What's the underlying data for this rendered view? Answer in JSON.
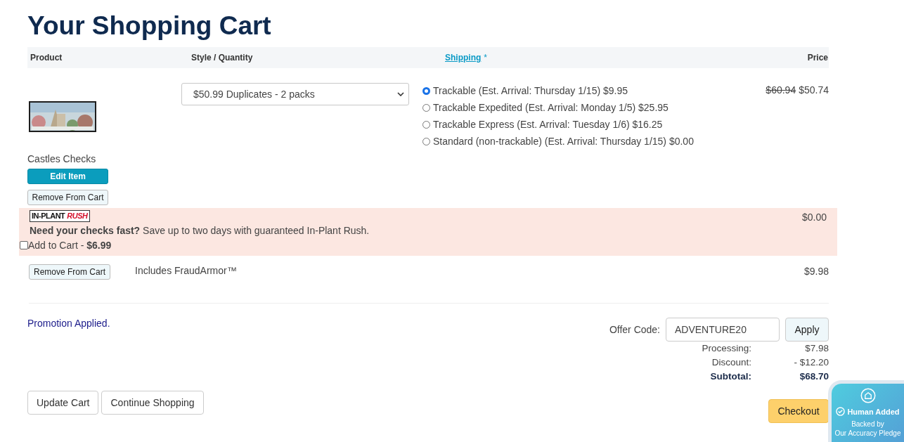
{
  "title": "Your Shopping Cart",
  "columns": [
    {
      "label": "Product",
      "kind": "plain"
    },
    {
      "label": "Style / Quantity",
      "kind": "plain"
    },
    {
      "label": "Shipping",
      "note": "*",
      "kind": "link"
    },
    {
      "label": "Price",
      "kind": "plain"
    }
  ],
  "item": {
    "name": "Castles Checks",
    "edit_button": "Edit Item",
    "remove_button": "Remove From Cart",
    "style_select": {
      "value": "$50.99 Duplicates - 2 packs"
    },
    "shipping_options": [
      {
        "label": "Trackable (Est. Arrival: Thursday 1/15) $9.95",
        "selected": true
      },
      {
        "label": "Trackable Expedited (Est. Arrival: Monday 1/5) $25.95",
        "selected": false
      },
      {
        "label": "Trackable Express (Est. Arrival: Tuesday 1/6) $16.25",
        "selected": false
      },
      {
        "label": "Standard (non-trackable) (Est. Arrival: Thursday 1/15) $0.00",
        "selected": false
      }
    ],
    "old_price": "$60.94",
    "price": "$50.74"
  },
  "rush": {
    "logo_left": "IN-PLANT",
    "logo_right": "RUSH",
    "text": "**Need your checks fast?** Save up to two days with guaranteed In-Plant Rush.",
    "add_label": "Add to Cart - **$6.99**",
    "checked": false,
    "price": "$0.00"
  },
  "addon": {
    "remove_button": "Remove From Cart",
    "text": "Includes FraudArmor™",
    "price": "$9.98"
  },
  "promotion": "Promotion Applied.",
  "offer": {
    "label": "Offer Code:",
    "value": "ADVENTURE20",
    "button": "Apply"
  },
  "totals": [
    {
      "label": "Processing:",
      "value": "$7.98",
      "bold": false
    },
    {
      "label": "Discount:",
      "value": "- $12.20",
      "bold": false
    },
    {
      "label": "Subtotal:",
      "value": "$68.70",
      "bold": true
    }
  ],
  "buttons": [
    "Update Cart",
    "Continue Shopping"
  ],
  "checkout": "Checkout",
  "badge": {
    "title": "Human Added",
    "line1": "Backed by",
    "line2": "Our Accuracy Pledge"
  }
}
